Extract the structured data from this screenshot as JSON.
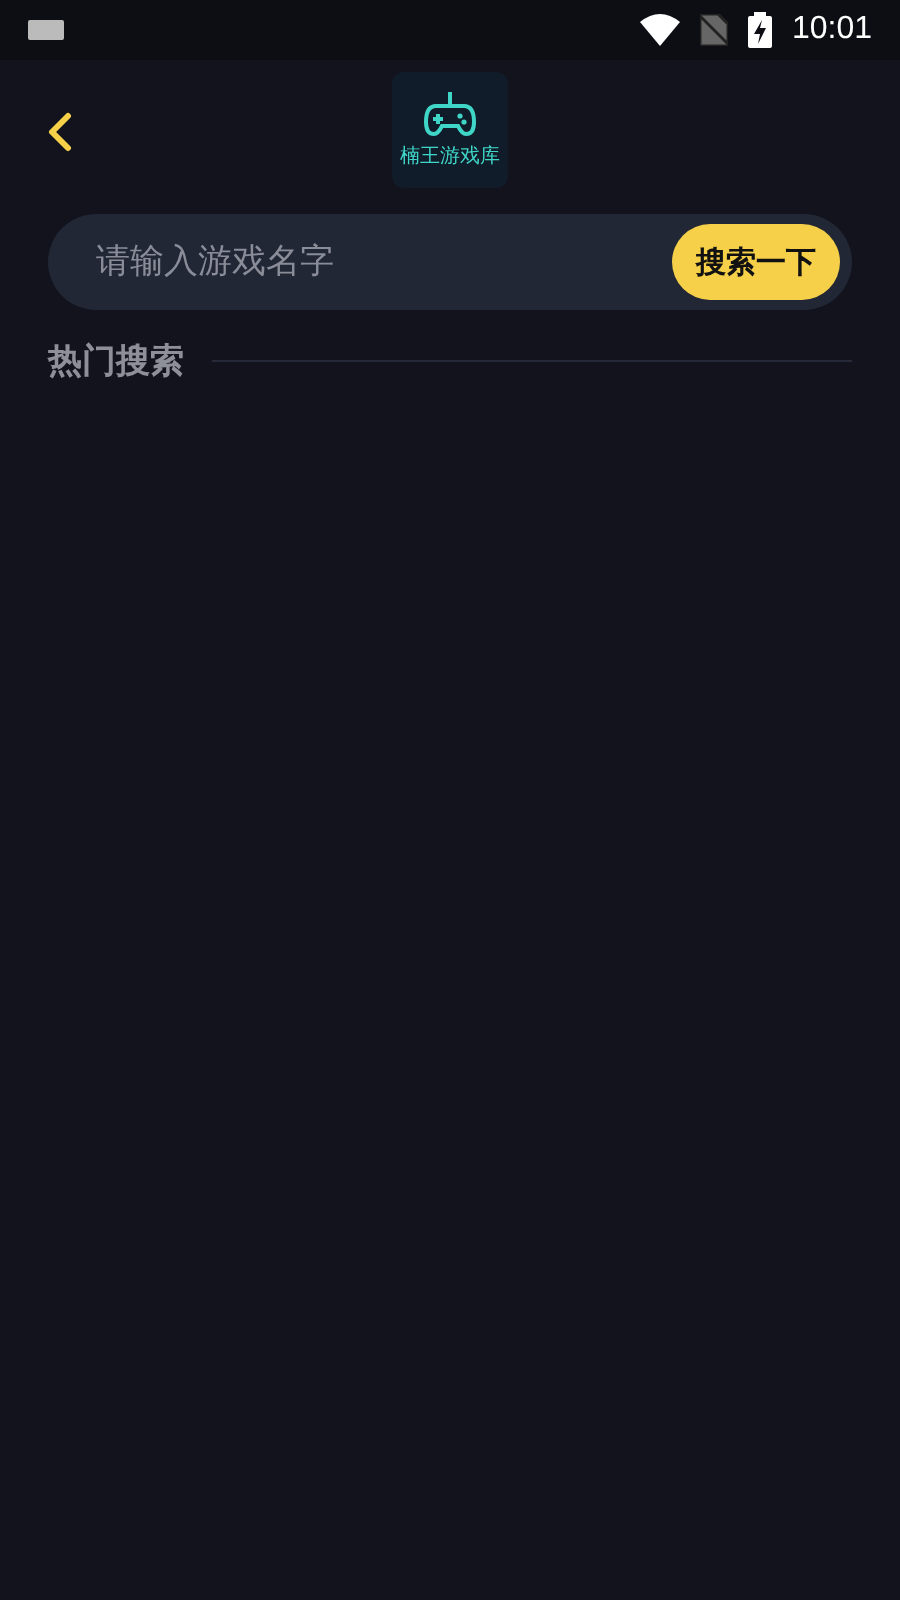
{
  "status_bar": {
    "time": "10:01"
  },
  "header": {
    "logo_text": "楠王游戏库"
  },
  "search": {
    "placeholder": "请输入游戏名字",
    "button": "搜索一下"
  },
  "hot_search": {
    "title": "热门搜索"
  }
}
